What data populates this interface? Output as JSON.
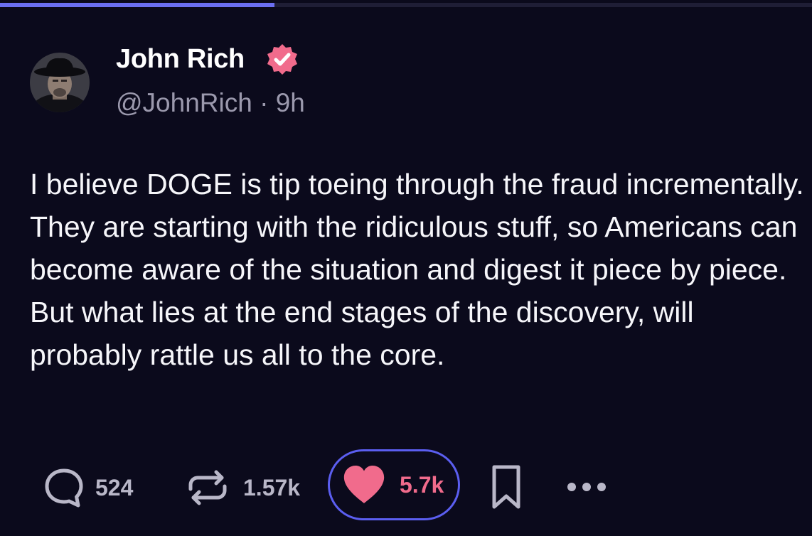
{
  "progress": {
    "fraction": 0.338,
    "fill_color": "#6b6ff2"
  },
  "author": {
    "display_name": "John Rich",
    "handle": "@JohnRich",
    "separator": "·",
    "time_ago": "9h",
    "verified": true
  },
  "post": {
    "text": "I believe DOGE is tip toeing through the fraud incrementally. They are starting with the ridiculous stuff, so Americans can become aware of the situation and digest it piece by piece. But what lies at the end stages of the discovery, will probably rattle us all to the core."
  },
  "actions": {
    "replies": "524",
    "reposts": "1.57k",
    "likes": "5.7k",
    "liked": true
  },
  "icons": {
    "reply": "speech-bubble-icon",
    "repost": "repost-arrows-icon",
    "like": "heart-icon",
    "bookmark": "bookmark-icon",
    "more": "more-dots-icon",
    "verified": "verified-badge-icon"
  },
  "colors": {
    "background": "#0b0a1c",
    "accent": "#5b5ef0",
    "like": "#f16b8c",
    "muted": "#9b99ad"
  }
}
